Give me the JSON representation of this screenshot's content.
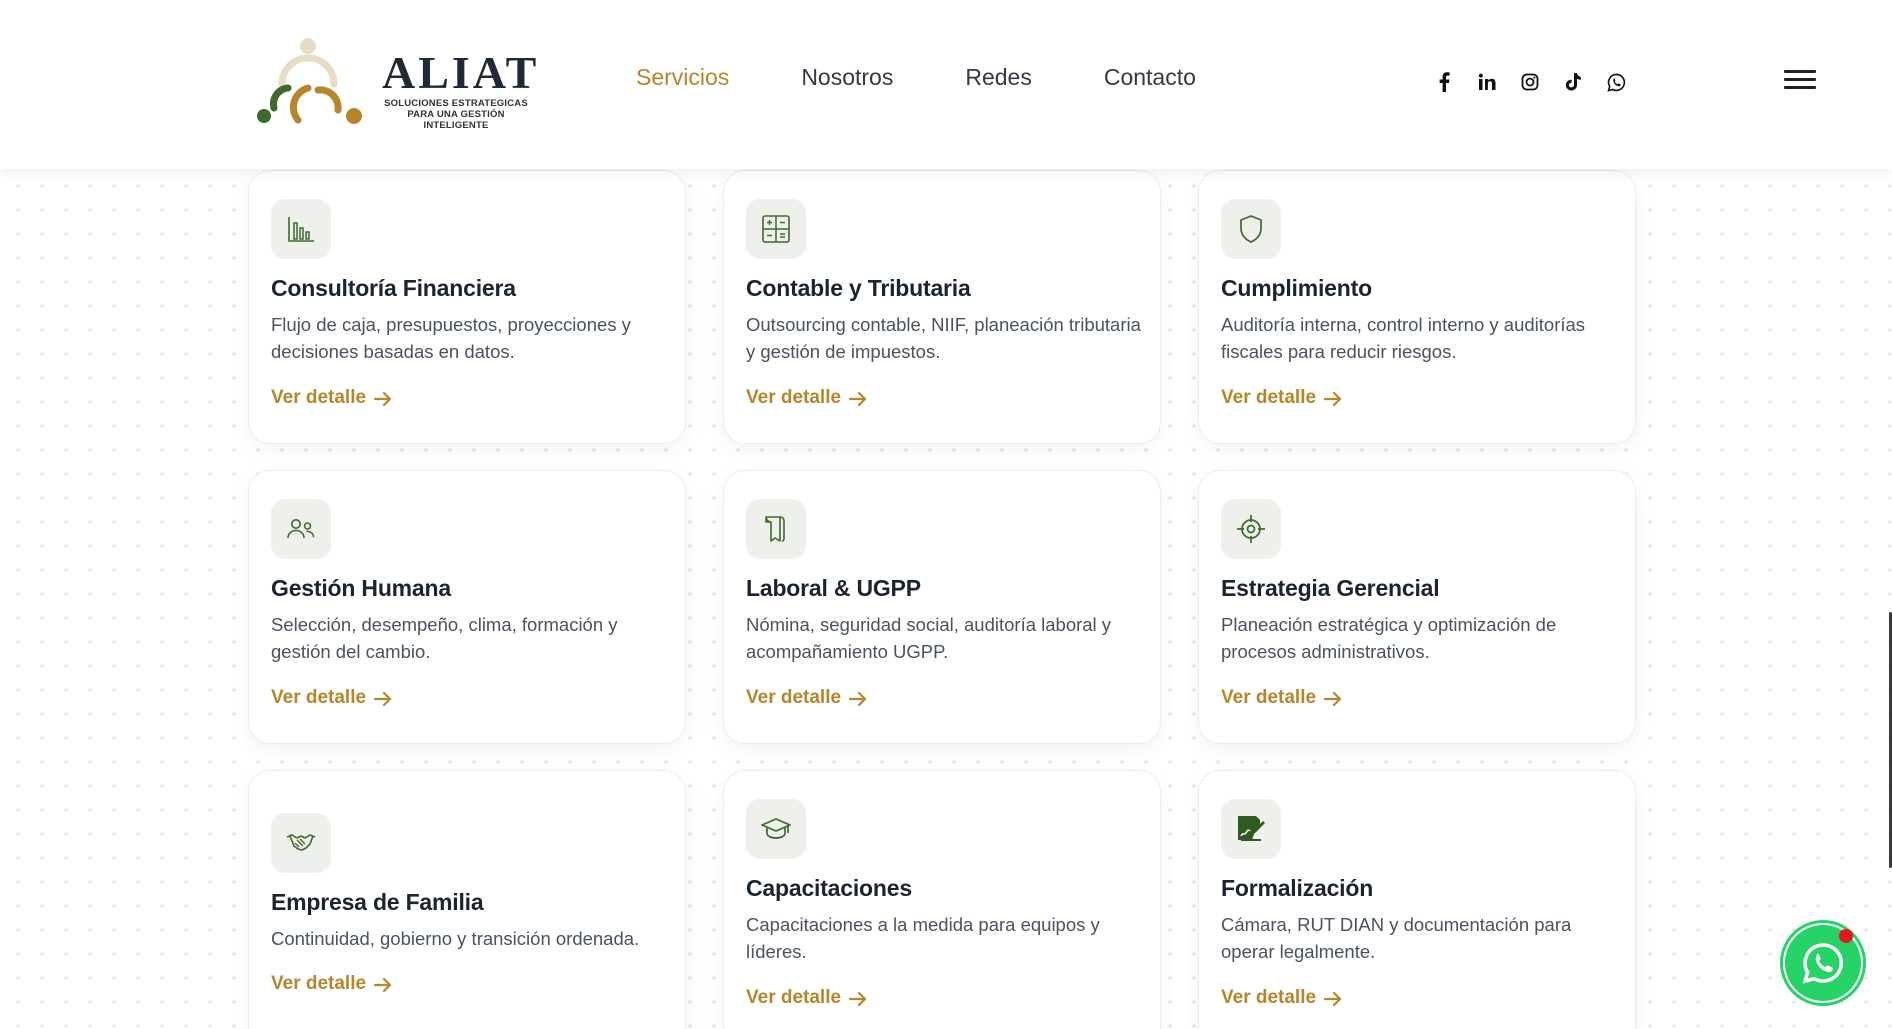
{
  "brand": {
    "name": "ALIAT",
    "tagline": "SOLUCIONES ESTRATEGICAS PARA UNA GESTIÓN INTELIGENTE",
    "colors": {
      "gold": "#b8862a",
      "green": "#3e6a2c",
      "dark": "#1b2532"
    }
  },
  "nav": {
    "items": [
      {
        "label": "Servicios",
        "active": true
      },
      {
        "label": "Nosotros",
        "active": false
      },
      {
        "label": "Redes",
        "active": false
      },
      {
        "label": "Contacto",
        "active": false
      }
    ]
  },
  "socials": [
    "facebook-icon",
    "linkedin-icon",
    "instagram-icon",
    "tiktok-icon",
    "whatsapp-icon"
  ],
  "services": [
    {
      "icon": "bar-chart-icon",
      "title": "Consultoría Financiera",
      "desc": "Flujo de caja, presupuestos, proyecciones y decisiones basadas en datos.",
      "link": "Ver detalle"
    },
    {
      "icon": "calculator-icon",
      "title": "Contable y Tributaria",
      "desc": "Outsourcing contable, NIIF, planeación tributaria y gestión de impuestos.",
      "link": "Ver detalle"
    },
    {
      "icon": "shield-icon",
      "title": "Cumplimiento",
      "desc": "Auditoría interna, control interno y auditorías fiscales para reducir riesgos.",
      "link": "Ver detalle"
    },
    {
      "icon": "users-icon",
      "title": "Gestión Humana",
      "desc": "Selección, desempeño, clima, formación y gestión del cambio.",
      "link": "Ver detalle"
    },
    {
      "icon": "document-icon",
      "title": "Laboral & UGPP",
      "desc": "Nómina, seguridad social, auditoría laboral y acompañamiento UGPP.",
      "link": "Ver detalle"
    },
    {
      "icon": "target-icon",
      "title": "Estrategia Gerencial",
      "desc": "Planeación estratégica y optimización de procesos administrativos.",
      "link": "Ver detalle"
    },
    {
      "icon": "handshake-icon",
      "title": "Empresa de Familia",
      "desc": "Continuidad, gobierno y transición ordenada.",
      "link": "Ver detalle"
    },
    {
      "icon": "graduation-cap-icon",
      "title": "Capacitaciones",
      "desc": "Capacitaciones a la medida para equipos y líderes.",
      "link": "Ver detalle"
    },
    {
      "icon": "signed-document-icon",
      "title": "Formalización",
      "desc": "Cámara, RUT DIAN y documentación para operar legalmente.",
      "link": "Ver detalle"
    }
  ]
}
